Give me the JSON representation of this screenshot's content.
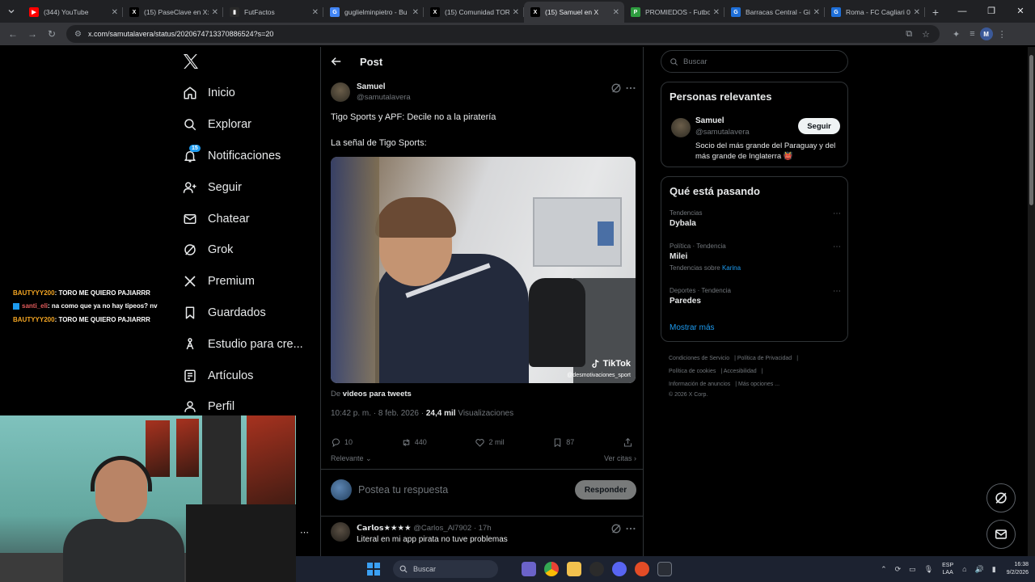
{
  "browser": {
    "tabs": [
      {
        "title": "(344) YouTube",
        "fav_color": "#ff0000",
        "fav_text": "▶"
      },
      {
        "title": "(15) PaseClave en X: ",
        "fav_color": "#000000",
        "fav_text": "X"
      },
      {
        "title": "FutFactos",
        "fav_color": "#2a2a2a",
        "fav_text": "▮"
      },
      {
        "title": "guglielminpietro - Bu",
        "fav_color": "#4285f4",
        "fav_text": "G"
      },
      {
        "title": "(15) Comunidad TOR",
        "fav_color": "#000000",
        "fav_text": "X"
      },
      {
        "title": "(15) Samuel en X",
        "fav_color": "#000000",
        "fav_text": "X",
        "active": true
      },
      {
        "title": "PROMIEDOS - Futbo",
        "fav_color": "#2e9c3f",
        "fav_text": "P"
      },
      {
        "title": "Barracas Central - Gi",
        "fav_color": "#1e6fd9",
        "fav_text": "G"
      },
      {
        "title": "Roma - FC Cagliari 0",
        "fav_color": "#1e6fd9",
        "fav_text": "G"
      }
    ],
    "url": "x.com/samutalavera/status/2020674713370886524?s=20"
  },
  "nav": {
    "items": [
      {
        "label": "Inicio",
        "icon": "home-icon"
      },
      {
        "label": "Explorar",
        "icon": "search-icon"
      },
      {
        "label": "Notificaciones",
        "icon": "bell-icon",
        "badge": "15"
      },
      {
        "label": "Seguir",
        "icon": "follow-icon"
      },
      {
        "label": "Chatear",
        "icon": "mail-icon"
      },
      {
        "label": "Grok",
        "icon": "grok-icon"
      },
      {
        "label": "Premium",
        "icon": "x-icon"
      },
      {
        "label": "Guardados",
        "icon": "bookmark-icon"
      },
      {
        "label": "Estudio para cre...",
        "icon": "creator-icon"
      },
      {
        "label": "Artículos",
        "icon": "article-icon"
      },
      {
        "label": "Perfil",
        "icon": "person-icon"
      }
    ]
  },
  "chat_overlay": [
    {
      "user": "BAUTYYY200",
      "msg": ": TORO ME QUIERO PAJIARRR",
      "user_color": "#f5a623"
    },
    {
      "user": "santi_eli",
      "msg": ": na como que ya no hay tipeos? nv",
      "user_color": "#e35b5b",
      "badge": true
    },
    {
      "user": "BAUTYYY200",
      "msg": ": TORO ME QUIERO PAJIARRR",
      "user_color": "#f5a623"
    }
  ],
  "post": {
    "header_title": "Post",
    "author_name": "Samuel",
    "author_handle": "@samutalavera",
    "text_line1": "Tigo Sports y APF: Decile no a la piratería",
    "text_line2": "La señal de Tigo Sports:",
    "tiktok_label": "TikTok",
    "tiktok_handle": "@desmotivaciones_sport",
    "from_prefix": "De",
    "from_source": "videos para tweets",
    "time": "10:42 p. m. · 8 feb. 2026 ·",
    "views_count": "24,4 mil",
    "views_label": "Visualizaciones",
    "replies": "10",
    "reposts": "440",
    "likes": "2 mil",
    "bookmarks": "87",
    "sort_label": "Relevante",
    "quotes_label": "Ver citas",
    "reply_placeholder": "Postea tu respuesta",
    "reply_button": "Responder"
  },
  "comment": {
    "name": "𝗖𝗮𝗿𝗹𝗼𝘀★★★★",
    "handle": "@Carlos_Al7902 · 17h",
    "text": "Literal en mi app pirata no tuve problemas"
  },
  "sidebar": {
    "search_placeholder": "Buscar",
    "relevant_title": "Personas relevantes",
    "relevant_name": "Samuel",
    "relevant_handle": "@samutalavera",
    "follow_label": "Seguir",
    "relevant_bio": "Socio del más grande del Paraguay y del más grande de Inglaterra 👹",
    "trending_title": "Qué está pasando",
    "trends": [
      {
        "category": "Tendencias",
        "name": "Dybala"
      },
      {
        "category": "Política · Tendencia",
        "name": "Milei",
        "sub_prefix": "Tendencias sobre",
        "sub_link": "Karina"
      },
      {
        "category": "Deportes · Tendencia",
        "name": "Paredes"
      }
    ],
    "show_more": "Mostrar más",
    "footer": {
      "terms": "Condiciones de Servicio",
      "privacy": "Política de Privacidad",
      "cookies": "Política de cookies",
      "accessibility": "Accesibilidad",
      "ads": "Información de anuncios",
      "more": "Más opciones ...",
      "copyright": "© 2026 X Corp."
    }
  },
  "taskbar": {
    "search_label": "Buscar",
    "lang_line1": "ESP",
    "lang_line2": "LAA",
    "time": "16:38",
    "date": "9/2/2026"
  },
  "colors": {
    "accent": "#1d9bf0",
    "background": "#000000",
    "border": "#2f3336",
    "muted": "#71767b"
  }
}
